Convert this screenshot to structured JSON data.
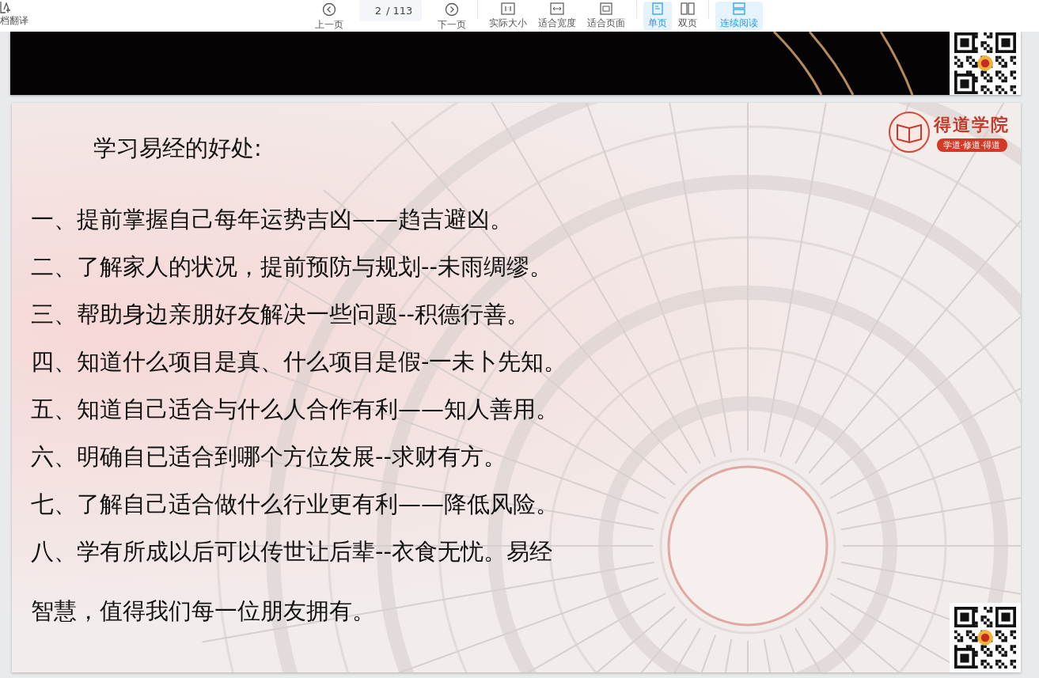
{
  "toolbar": {
    "left_tool": {
      "label": "档翻译"
    },
    "nav": [
      {
        "kind": "prev",
        "label": "上一页"
      },
      {
        "kind": "page",
        "value": "2",
        "total": "/ 113"
      },
      {
        "kind": "next",
        "label": "下一页"
      }
    ],
    "groups": [
      [
        {
          "kind": "actual",
          "label": "实际大小",
          "selected": false
        },
        {
          "kind": "fitwidth",
          "label": "适合宽度",
          "selected": false
        },
        {
          "kind": "fitpage",
          "label": "适合页面",
          "selected": false
        }
      ],
      [
        {
          "kind": "single",
          "label": "单页",
          "selected": true
        },
        {
          "kind": "double",
          "label": "双页",
          "selected": false
        }
      ],
      [
        {
          "kind": "continuous",
          "label": "连续阅读",
          "selected": true
        }
      ]
    ]
  },
  "slide": {
    "heading": "学习易经的好处:",
    "logo": {
      "name": "得道学院",
      "motto": "学道·修道·得道"
    },
    "lines": [
      "一、提前掌握自己每年运势吉凶——趋吉避凶。",
      "二、了解家人的状况，提前预防与规划--未雨绸缪。",
      "三、帮助身边亲朋好友解决一些问题--积德行善。",
      "四、知道什么项目是真、什么项目是假-一未卜先知。",
      "五、知道自己适合与什么人合作有利——知人善用。",
      "六、明确自已适合到哪个方位发展--求财有方。",
      "七、了解自己适合做什么行业更有利——降低风险。",
      "八、学有所成以后可以传世让后辈--衣食无忧。易经",
      "智慧，值得我们每一位朋友拥有。"
    ]
  }
}
